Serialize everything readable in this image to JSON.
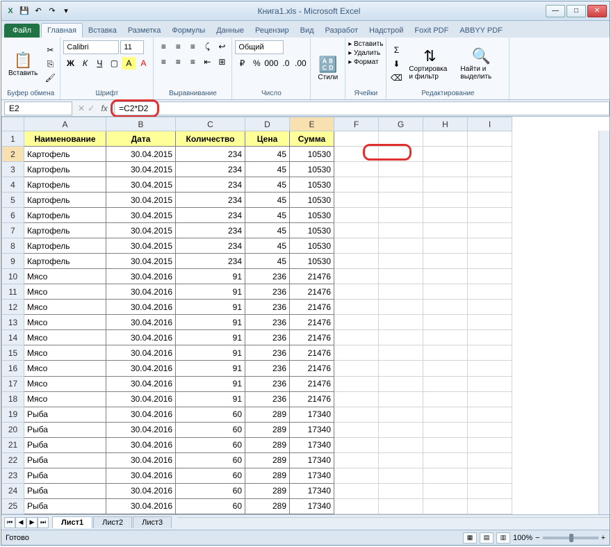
{
  "title": "Книга1.xls - Microsoft Excel",
  "qat": {
    "excel_icon": "X",
    "save": "💾",
    "undo": "↶",
    "redo": "↷"
  },
  "tabs": {
    "file": "Файл",
    "items": [
      "Главная",
      "Вставка",
      "Разметка",
      "Формулы",
      "Данные",
      "Рецензир",
      "Вид",
      "Разработ",
      "Надстрой",
      "Foxit PDF",
      "ABBYY PDF"
    ],
    "active": 0
  },
  "ribbon": {
    "clipboard": {
      "paste": "Вставить",
      "label": "Буфер обмена"
    },
    "font": {
      "name": "Calibri",
      "size": "11",
      "label": "Шрифт"
    },
    "align": {
      "label": "Выравнивание"
    },
    "number": {
      "format": "Общий",
      "label": "Число"
    },
    "styles": {
      "btn": "Стили"
    },
    "cells": {
      "insert": "Вставить",
      "delete": "Удалить",
      "format": "Формат",
      "label": "Ячейки"
    },
    "editing": {
      "sort": "Сортировка и фильтр",
      "find": "Найти и выделить",
      "label": "Редактирование"
    }
  },
  "namebox": "E2",
  "formula": "=C2*D2",
  "columns": [
    "A",
    "B",
    "C",
    "D",
    "E",
    "F",
    "G",
    "H",
    "I"
  ],
  "headers": [
    "Наименование",
    "Дата",
    "Количество",
    "Цена",
    "Сумма"
  ],
  "rows": [
    {
      "n": 2,
      "a": "Картофель",
      "b": "30.04.2015",
      "c": "234",
      "d": "45",
      "e": "10530"
    },
    {
      "n": 3,
      "a": "Картофель",
      "b": "30.04.2015",
      "c": "234",
      "d": "45",
      "e": "10530"
    },
    {
      "n": 4,
      "a": "Картофель",
      "b": "30.04.2015",
      "c": "234",
      "d": "45",
      "e": "10530"
    },
    {
      "n": 5,
      "a": "Картофель",
      "b": "30.04.2015",
      "c": "234",
      "d": "45",
      "e": "10530"
    },
    {
      "n": 6,
      "a": "Картофель",
      "b": "30.04.2015",
      "c": "234",
      "d": "45",
      "e": "10530"
    },
    {
      "n": 7,
      "a": "Картофель",
      "b": "30.04.2015",
      "c": "234",
      "d": "45",
      "e": "10530"
    },
    {
      "n": 8,
      "a": "Картофель",
      "b": "30.04.2015",
      "c": "234",
      "d": "45",
      "e": "10530"
    },
    {
      "n": 9,
      "a": "Картофель",
      "b": "30.04.2015",
      "c": "234",
      "d": "45",
      "e": "10530"
    },
    {
      "n": 10,
      "a": "Мясо",
      "b": "30.04.2016",
      "c": "91",
      "d": "236",
      "e": "21476"
    },
    {
      "n": 11,
      "a": "Мясо",
      "b": "30.04.2016",
      "c": "91",
      "d": "236",
      "e": "21476"
    },
    {
      "n": 12,
      "a": "Мясо",
      "b": "30.04.2016",
      "c": "91",
      "d": "236",
      "e": "21476"
    },
    {
      "n": 13,
      "a": "Мясо",
      "b": "30.04.2016",
      "c": "91",
      "d": "236",
      "e": "21476"
    },
    {
      "n": 14,
      "a": "Мясо",
      "b": "30.04.2016",
      "c": "91",
      "d": "236",
      "e": "21476"
    },
    {
      "n": 15,
      "a": "Мясо",
      "b": "30.04.2016",
      "c": "91",
      "d": "236",
      "e": "21476"
    },
    {
      "n": 16,
      "a": "Мясо",
      "b": "30.04.2016",
      "c": "91",
      "d": "236",
      "e": "21476"
    },
    {
      "n": 17,
      "a": "Мясо",
      "b": "30.04.2016",
      "c": "91",
      "d": "236",
      "e": "21476"
    },
    {
      "n": 18,
      "a": "Мясо",
      "b": "30.04.2016",
      "c": "91",
      "d": "236",
      "e": "21476"
    },
    {
      "n": 19,
      "a": "Рыба",
      "b": "30.04.2016",
      "c": "60",
      "d": "289",
      "e": "17340"
    },
    {
      "n": 20,
      "a": "Рыба",
      "b": "30.04.2016",
      "c": "60",
      "d": "289",
      "e": "17340"
    },
    {
      "n": 21,
      "a": "Рыба",
      "b": "30.04.2016",
      "c": "60",
      "d": "289",
      "e": "17340"
    },
    {
      "n": 22,
      "a": "Рыба",
      "b": "30.04.2016",
      "c": "60",
      "d": "289",
      "e": "17340"
    },
    {
      "n": 23,
      "a": "Рыба",
      "b": "30.04.2016",
      "c": "60",
      "d": "289",
      "e": "17340"
    },
    {
      "n": 24,
      "a": "Рыба",
      "b": "30.04.2016",
      "c": "60",
      "d": "289",
      "e": "17340"
    },
    {
      "n": 25,
      "a": "Рыба",
      "b": "30.04.2016",
      "c": "60",
      "d": "289",
      "e": "17340"
    }
  ],
  "sheets": [
    "Лист1",
    "Лист2",
    "Лист3"
  ],
  "status": "Готово",
  "zoom": "100%"
}
